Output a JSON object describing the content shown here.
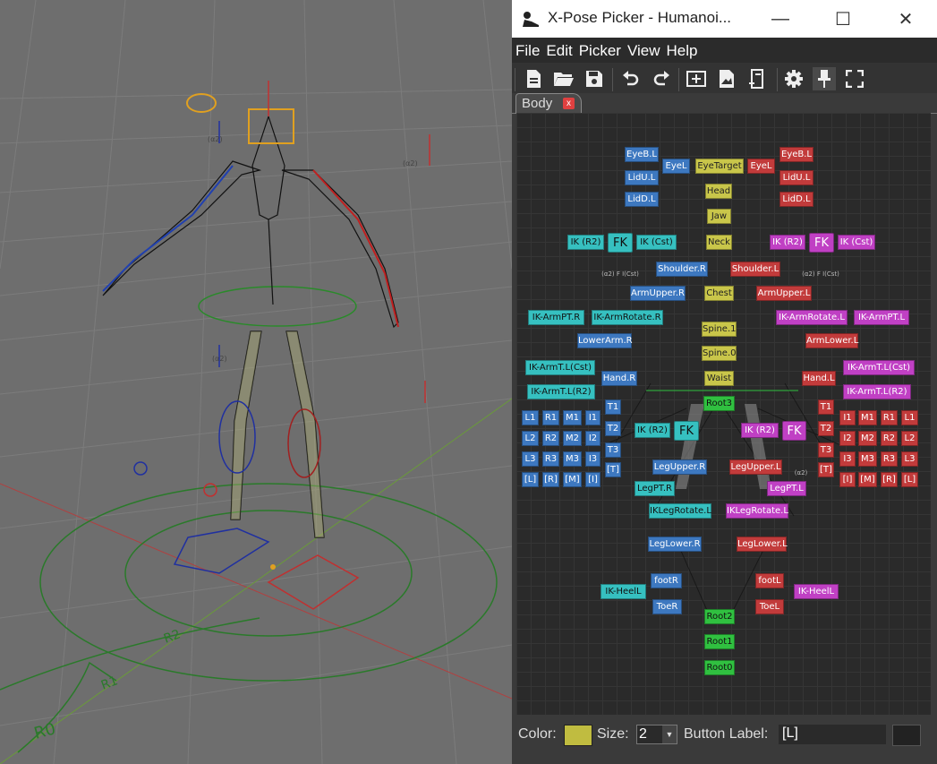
{
  "window": {
    "title": "X-Pose Picker - Humanoi...",
    "controls": {
      "minimize": "—",
      "maximize": "☐",
      "close": "✕"
    }
  },
  "menu": [
    "File",
    "Edit",
    "Picker",
    "View",
    "Help"
  ],
  "toolbar": [
    "new-file-icon",
    "open-folder-icon",
    "save-icon",
    "undo-icon",
    "redo-icon",
    "add-image-icon",
    "image-edit-icon",
    "rename-icon",
    "gear-icon",
    "pin-icon",
    "fullscreen-icon"
  ],
  "tab": {
    "label": "Body",
    "close": "x"
  },
  "viewport": {
    "ground_labels": [
      "R2",
      "R1",
      "R0"
    ],
    "small_labels": [
      "(α2)",
      "F",
      "I(Cst)"
    ]
  },
  "colors": {
    "blue": "#3d78c0",
    "red": "#c23b3b",
    "yellow": "#c9c64a",
    "cyan": "#36c0c0",
    "magenta": "#c040c4",
    "green": "#30c040",
    "color_swatch": "#c0bc40"
  },
  "pickers": {
    "eye_b_r": "EyeB.L",
    "eye_r": "EyeL",
    "eye_target": "EyeTarget",
    "eye_l": "EyeL",
    "eye_b_l": "EyeB.L",
    "lid_ul_r": "LidU.L",
    "lid_ul_l": "LidU.L",
    "lid_dl_r": "LidD.L",
    "lid_dl_l": "LidD.L",
    "head": "Head",
    "jaw": "Jaw",
    "neck": "Neck",
    "ik_r2_r": "IK (R2)",
    "fk_r": "FK",
    "ik_cst_r": "IK (Cst)",
    "ik_r2_l": "IK (R2)",
    "fk_l": "FK",
    "ik_cst_l": "IK (Cst)",
    "shoulder_r": "Shoulder.R",
    "shoulder_l": "Shoulder.L",
    "arm_upper_r": "ArmUpper.R",
    "chest": "Chest",
    "arm_upper_l": "ArmUpper.L",
    "ik_armpt_r": "IK-ArmPT.R",
    "ik_armrotate_r": "IK-ArmRotate.R",
    "ik_armrotate_l": "IK-ArmRotate.L",
    "ik_armpt_l": "IK-ArmPT.L",
    "spine1": "Spine.1",
    "lower_arm_r": "LowerArm.R",
    "arm_lower_l": "ArmLower.L",
    "spine0": "Spine.0",
    "ik_armtl_cst_r": "IK-ArmT.L(Cst)",
    "hand_r": "Hand.R",
    "waist": "Waist",
    "hand_l": "Hand.L",
    "ik_armtl_cst_l": "IK-ArmT.L(Cst)",
    "ik_armtl_r2_r": "IK-ArmT.L(R2)",
    "ik_armtl_r2_l": "IK-ArmT.L(R2)",
    "root3": "Root3",
    "leg_ik_r2_r": "IK (R2)",
    "leg_fk_r": "FK",
    "leg_ik_r2_l": "IK (R2)",
    "leg_fk_l": "FK",
    "leg_upper_r": "LegUpper.R",
    "leg_upper_l": "LegUpper.L",
    "leg_pt_r": "LegPT.R",
    "leg_pt_l": "LegPT.L",
    "ik_leg_rotate_r": "IKLegRotate.L",
    "ik_leg_rotate_l": "IKLegRotate.L",
    "leg_lower_r": "LegLower.R",
    "leg_lower_l": "LegLower.L",
    "foot_r": "footR",
    "foot_l": "footL",
    "ik_heel_r": "IK-HeelL",
    "ik_heel_l": "IK-HeelL",
    "toe_r": "ToeR",
    "toe_l": "ToeL",
    "root2": "Root2",
    "root1": "Root1",
    "root0": "Root0",
    "fingers_r": [
      [
        "L1",
        "R1",
        "M1",
        "I1"
      ],
      [
        "L2",
        "R2",
        "M2",
        "I2"
      ],
      [
        "L3",
        "R3",
        "M3",
        "I3"
      ],
      [
        "[L]",
        "[R]",
        "[M]",
        "[I]"
      ]
    ],
    "thumb_r": [
      "T1",
      "T2",
      "T3",
      "[T]"
    ],
    "fingers_l": [
      [
        "I1",
        "M1",
        "R1",
        "L1"
      ],
      [
        "I2",
        "M2",
        "R2",
        "L2"
      ],
      [
        "I3",
        "M3",
        "R3",
        "L3"
      ],
      [
        "[I]",
        "[M]",
        "[R]",
        "[L]"
      ]
    ],
    "thumb_l": [
      "T1",
      "T2",
      "T3",
      "[T]"
    ],
    "small_r": "(α2)  F  I(Cst)",
    "small_l": "(α2)  F  I(Cst)",
    "small_mid": "(α2)"
  },
  "bottom": {
    "color_label": "Color:",
    "size_label": "Size:",
    "size_value": "2",
    "button_label_label": "Button Label:",
    "button_label_value": "[L]"
  }
}
